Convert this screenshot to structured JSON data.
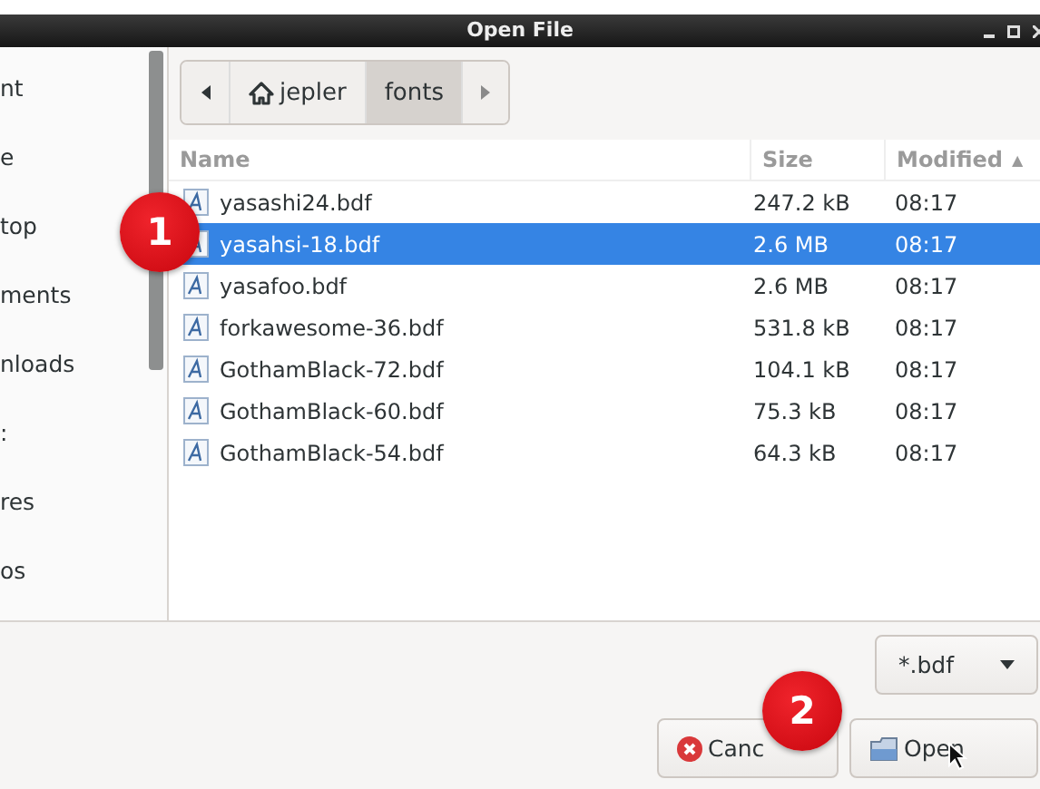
{
  "window": {
    "title": "Open File"
  },
  "sidebar": {
    "items": [
      {
        "label": "nt"
      },
      {
        "label": "e"
      },
      {
        "label": "top"
      },
      {
        "label": "ments"
      },
      {
        "label": "nloads"
      },
      {
        "label": ":"
      },
      {
        "label": "res"
      },
      {
        "label": "os"
      }
    ]
  },
  "path_bar": {
    "segments": [
      {
        "label": "jepler",
        "kind": "home",
        "selected": false
      },
      {
        "label": "fonts",
        "kind": "folder",
        "selected": true
      }
    ]
  },
  "file_list": {
    "columns": [
      {
        "label": "Name"
      },
      {
        "label": "Size"
      },
      {
        "label": "Modified",
        "sort_indicator": "▲"
      }
    ],
    "rows": [
      {
        "name": "yasashi24.bdf",
        "size": "247.2 kB",
        "modified": "08:17",
        "selected": false
      },
      {
        "name": "yasahsi-18.bdf",
        "size": "2.6 MB",
        "modified": "08:17",
        "selected": true
      },
      {
        "name": "yasafoo.bdf",
        "size": "2.6 MB",
        "modified": "08:17",
        "selected": false
      },
      {
        "name": "forkawesome-36.bdf",
        "size": "531.8 kB",
        "modified": "08:17",
        "selected": false
      },
      {
        "name": "GothamBlack-72.bdf",
        "size": "104.1 kB",
        "modified": "08:17",
        "selected": false
      },
      {
        "name": "GothamBlack-60.bdf",
        "size": "75.3 kB",
        "modified": "08:17",
        "selected": false
      },
      {
        "name": "GothamBlack-54.bdf",
        "size": "64.3 kB",
        "modified": "08:17",
        "selected": false
      }
    ]
  },
  "filter": {
    "value": "*.bdf"
  },
  "buttons": [
    {
      "label": "Canc",
      "kind": "cancel"
    },
    {
      "label": "Open",
      "kind": "open"
    }
  ],
  "badges": [
    {
      "label": "1"
    },
    {
      "label": "2"
    }
  ]
}
